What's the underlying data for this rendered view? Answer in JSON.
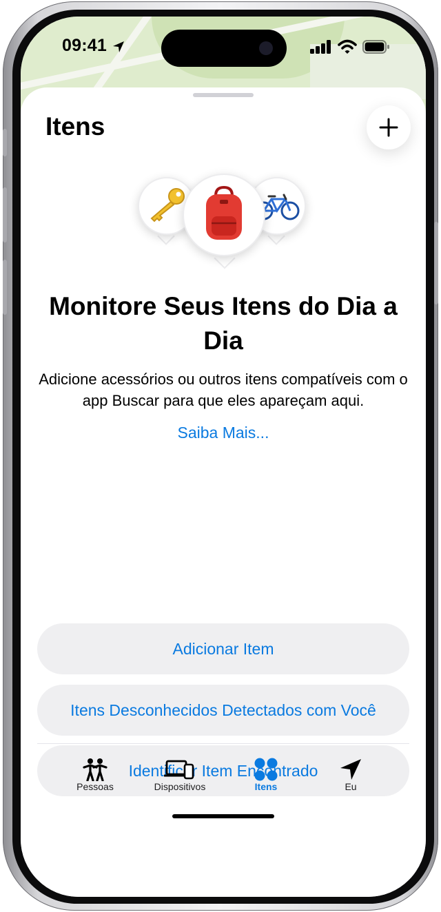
{
  "status_bar": {
    "time": "09:41",
    "location_icon": "location-arrow-icon",
    "icons": [
      "cellular-signal-icon",
      "wifi-icon",
      "battery-icon"
    ]
  },
  "header": {
    "title": "Itens",
    "add_icon": "plus-icon"
  },
  "illustration": {
    "icons": [
      "key-icon",
      "backpack-icon",
      "bicycle-icon"
    ]
  },
  "empty_state": {
    "headline": "Monitore Seus Itens do Dia a Dia",
    "description": "Adicione acessórios ou outros itens compatíveis com o app Buscar para que eles apareçam aqui.",
    "learn_more": "Saiba Mais..."
  },
  "actions": {
    "add_item": "Adicionar Item",
    "unknown_items": "Itens Desconhecidos Detectados com Você",
    "identify_found": "Identificar Item Encontrado"
  },
  "tabs": [
    {
      "label": "Pessoas",
      "icon": "people-icon",
      "active": false
    },
    {
      "label": "Dispositivos",
      "icon": "devices-icon",
      "active": false
    },
    {
      "label": "Itens",
      "icon": "items-icon",
      "active": true
    },
    {
      "label": "Eu",
      "icon": "location-arrow-icon",
      "active": false
    }
  ],
  "colors": {
    "accent": "#0a7ae0",
    "pill_background": "#efeff1",
    "map": "#dfeccd"
  }
}
